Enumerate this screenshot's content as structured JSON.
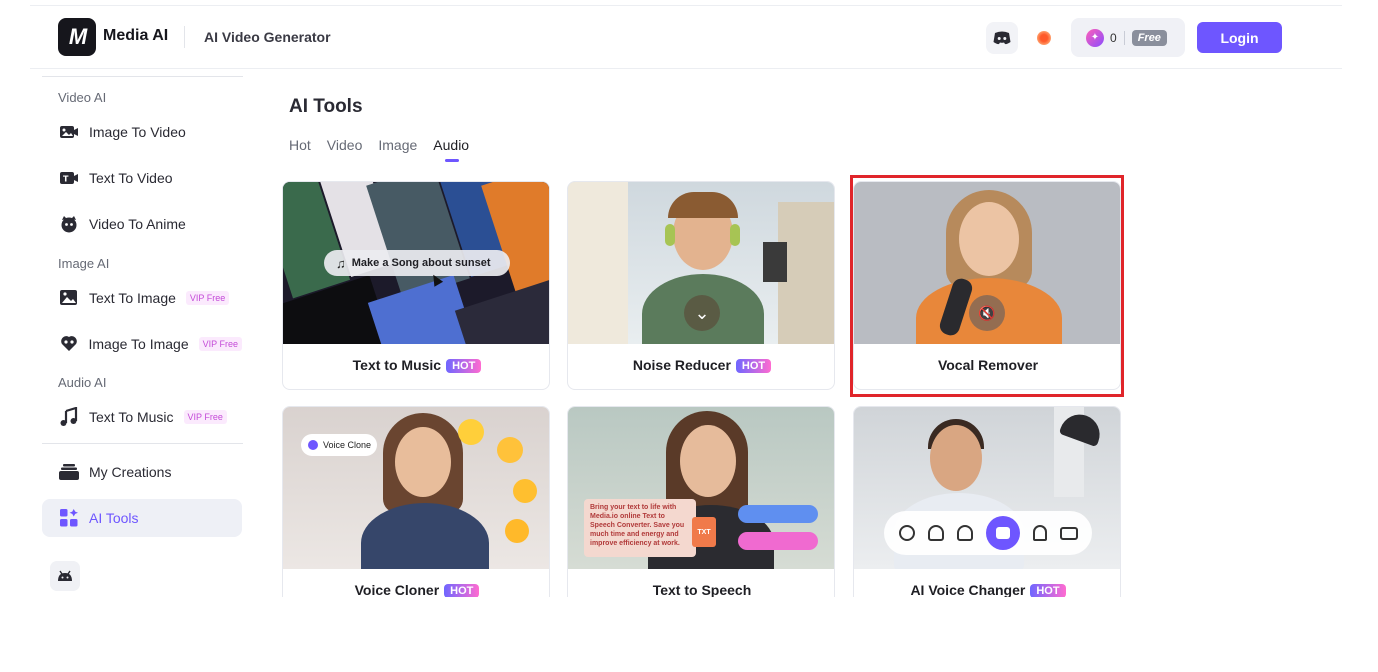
{
  "header": {
    "brand": "Media AI",
    "subtitle": "AI Video Generator",
    "credits": "0",
    "plan": "Free",
    "login_label": "Login"
  },
  "sidebar": {
    "sections": [
      {
        "label": "Video AI"
      },
      {
        "label": "Image AI"
      },
      {
        "label": "Audio AI"
      }
    ],
    "items": [
      {
        "label": "Image To Video",
        "icon": "image-to-video-icon"
      },
      {
        "label": "Text To Video",
        "icon": "text-to-video-icon"
      },
      {
        "label": "Video To Anime",
        "icon": "anime-icon"
      },
      {
        "label": "Text To Image",
        "icon": "text-to-image-icon",
        "badge": "VIP Free"
      },
      {
        "label": "Image To Image",
        "icon": "image-to-image-icon",
        "badge": "VIP Free"
      },
      {
        "label": "Text To Music",
        "icon": "music-note-icon",
        "badge": "VIP Free"
      },
      {
        "label": "My Creations",
        "icon": "creations-icon"
      },
      {
        "label": "AI Tools",
        "icon": "grid-icon",
        "active": true
      }
    ]
  },
  "main": {
    "title": "AI Tools",
    "tabs": [
      {
        "label": "Hot"
      },
      {
        "label": "Video"
      },
      {
        "label": "Image"
      },
      {
        "label": "Audio",
        "active": true
      }
    ],
    "cards": [
      {
        "title": "Text to Music",
        "badge": "HOT",
        "overlay": "Make a Song about sunset"
      },
      {
        "title": "Noise Reducer",
        "badge": "HOT"
      },
      {
        "title": "Vocal Remover",
        "highlighted": true
      },
      {
        "title": "Voice Cloner",
        "badge": "HOT",
        "overlay": "Voice Clone"
      },
      {
        "title": "Text to Speech",
        "overlay": "Bring your text to life with Media.io online Text to Speech Converter. Save you much time and energy and improve efficiency at work.",
        "overlay_tag": "TXT"
      },
      {
        "title": "AI Voice Changer",
        "badge": "HOT"
      }
    ]
  },
  "colors": {
    "accent": "#6e56ff",
    "highlight": "#e0252a",
    "vip": "#c44bd8"
  }
}
